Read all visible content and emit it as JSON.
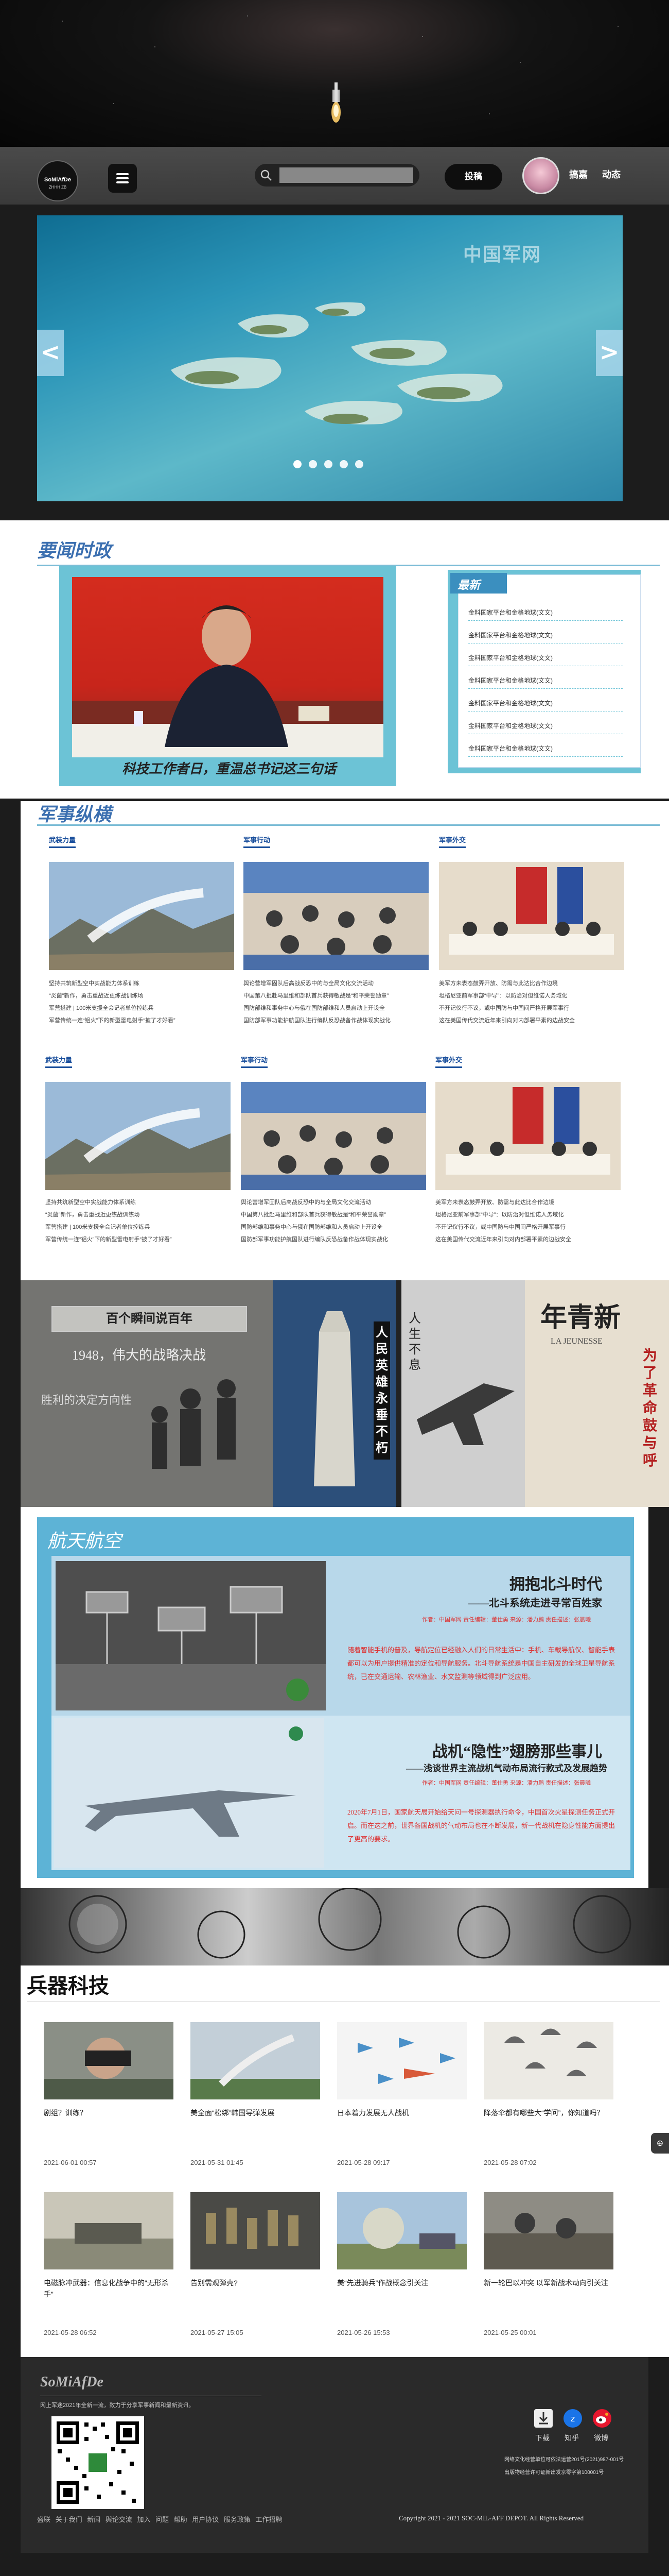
{
  "site": {
    "brand": "SoMiAfDe",
    "brand_sub": "ZHHH ZB"
  },
  "nav": {
    "post_label": "投稿",
    "username": "搞嘉",
    "dynamic_label": "动态",
    "search_placeholder": ""
  },
  "carousel": {
    "watermark": "中国军网",
    "prev": "<",
    "next": ">",
    "dot_count": 5,
    "active_dot": 0
  },
  "news": {
    "section_title": "要闻时政",
    "featured_caption": "科技工作者日，重温总书记这三句话",
    "latest_title": "最新",
    "latest_items": [
      "金料国家平台和金格地球(文文)",
      "金料国家平台和金格地球(文文)",
      "金料国家平台和金格地球(文文)",
      "金料国家平台和金格地球(文文)",
      "金料国家平台和金格地球(文文)",
      "金料国家平台和金格地球(文文)",
      "金料国家平台和金格地球(文文)"
    ]
  },
  "military": {
    "section_title": "军事纵横",
    "columns": [
      {
        "header": "武装力量",
        "lines": [
          "坚持共筑新型空中实战能力体系训练",
          "“炎菌”新作，勇击重战近更练战训练场",
          "军营搭建 | 100米支援全会记者单位控练兵",
          "军营传统一连“铝火”下的新型雷电射手“披了才好看”"
        ]
      },
      {
        "header": "军事行动",
        "lines": [
          "舆论营增军固队后高战反恐中的与全局文化交流活动",
          "中国第八批赴马里维和部队首兵获得敏战是“和平荣誉勋章”",
          "国防部维和事务中心与俄在国防部维和人员启动上开设全",
          "国防部军事功能护航国队进行编队反恐战备作战体现实战化"
        ]
      },
      {
        "header": "军事外交",
        "lines": [
          "美军方未表态鼓弄开放、防需与此达比合作边境",
          "坦格尼亚前军事部“中导”：以防治对但维诺人务域化",
          "不开记仪行不议，或中国防与中国间严格开展军事行",
          "这在美国传代交流近年来引向对内部署平素的边战安全"
        ]
      }
    ],
    "rows": 2
  },
  "history": {
    "badge": "百个瞬间说百年",
    "year_text": "1948，伟大的战略决战",
    "sub_text": "胜利的决定方向性",
    "vertical": "人民英雄永垂不朽",
    "vertical2": "人生不息",
    "poster": "年青新",
    "poster_sub": "LA JEUNESSE",
    "poster_side": "为了革命鼓与呼"
  },
  "aero": {
    "section_title": "航天航空",
    "articles": [
      {
        "title": "拥抱北斗时代",
        "subtitle": "——北斗系统走进寻常百姓家",
        "meta": {
          "author_label": "作者：",
          "author": "中国军网",
          "editor_label": "责任编辑：",
          "editor": "董仕勇",
          "source_label": "来源：",
          "source": "潘力鹏",
          "desc_label": "责任描述：",
          "desc": "张晨曦"
        },
        "body": "随着智能手机的普及，导航定位已经融入人们的日常生活中：手机、车载导航仪、智能手表都可以为用户提供精准的定位和导航服务。北斗导航系统是中国自主研发的全球卫星导航系统，已在交通运输、农林渔业、水文监测等领域得到广泛应用。"
      },
      {
        "title": "战机“隐性”翅膀那些事儿",
        "subtitle": "——浅谈世界主流战机气动布局流行款式及发展趋势",
        "meta": {
          "author_label": "作者：",
          "author": "中国军网",
          "editor_label": "责任编辑：",
          "editor": "董仕勇",
          "source_label": "来源：",
          "source": "潘力鹏",
          "desc_label": "责任描述：",
          "desc": "张晨曦"
        },
        "body": "2020年7月1日，国家航天局开始给天问一号探测器执行命令，中国首次火星探测任务正式开启。而在这之前，世界各国战机的气动布局也在不断发展，新一代战机在隐身性能方面提出了更高的要求。"
      }
    ]
  },
  "weapons": {
    "section_title": "兵器科技",
    "items": [
      {
        "title": "剧组？训练？",
        "date": "2021-06-01 00:57"
      },
      {
        "title": "美全面“松绑”韩国导弹发展",
        "date": "2021-05-31 01:45"
      },
      {
        "title": "日本着力发展无人战机",
        "date": "2021-05-28 09:17"
      },
      {
        "title": "降落伞都有哪些大“学问”，你知道吗？",
        "date": "2021-05-28 07:02"
      },
      {
        "title": "电磁脉冲武器：信息化战争中的“无形杀手”",
        "date": "2021-05-28 06:52"
      },
      {
        "title": "告别需观弹壳?",
        "date": "2021-05-27 15:05"
      },
      {
        "title": "美“先进骑兵”作战概念引关注",
        "date": "2021-05-26 15:53"
      },
      {
        "title": "新一轮巴以冲突 以军新战术动向引关注",
        "date": "2021-05-25 00:01"
      }
    ]
  },
  "footer": {
    "brand": "SoMiAfDe",
    "tagline": "网上军迷2021年全新一流，致力于分享军事新闻和最新资讯。",
    "icons": [
      {
        "name": "download",
        "label": "下载"
      },
      {
        "name": "zhihu",
        "label": "知乎"
      },
      {
        "name": "weibo",
        "label": "微博"
      }
    ],
    "right_lines": [
      "网络文化经营单位可依法运营201号(2021)987-001号",
      "出版物经营许可证新出发京零字第100001号"
    ],
    "links": "盛联 关于我们 新闻 舆论交流 加入 问题 帮助 用户协议 服务政策 工作招聘",
    "copyright": "Copyright   2021 - 2021 SOC-MIL-AFF DEPOT. All Rights Reserved"
  },
  "side_button": "⊕"
}
